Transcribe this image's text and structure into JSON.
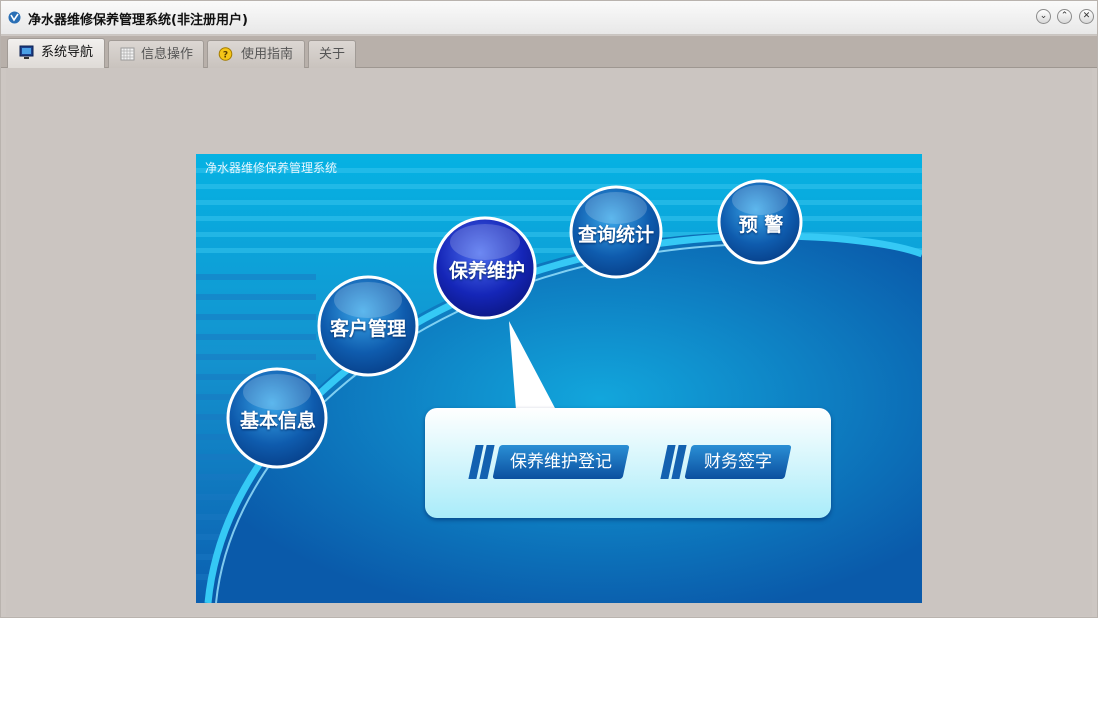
{
  "window": {
    "title": "净水器维修保养管理系统(非注册用户)"
  },
  "window_controls": {
    "minimize": "⌄",
    "restore": "⌃",
    "close": "✕"
  },
  "tabs": [
    {
      "label": "系统导航",
      "icon": "monitor-icon",
      "active": true
    },
    {
      "label": "信息操作",
      "icon": "grid-icon",
      "active": false
    },
    {
      "label": "使用指南",
      "icon": "help-icon",
      "active": false
    },
    {
      "label": "关于",
      "icon": "",
      "active": false
    }
  ],
  "banner": {
    "title": "净水器维修保养管理系统",
    "modules": [
      "基本信息",
      "客户管理",
      "保养维护",
      "查询统计",
      "预 警"
    ],
    "popup": {
      "items": [
        "保养维护登记",
        "财务签字"
      ]
    }
  },
  "colors": {
    "banner_top": "#05b2e3",
    "banner_bottom": "#0b5fb0",
    "active_module": "#1526b8",
    "module": "#0d4f9e"
  }
}
